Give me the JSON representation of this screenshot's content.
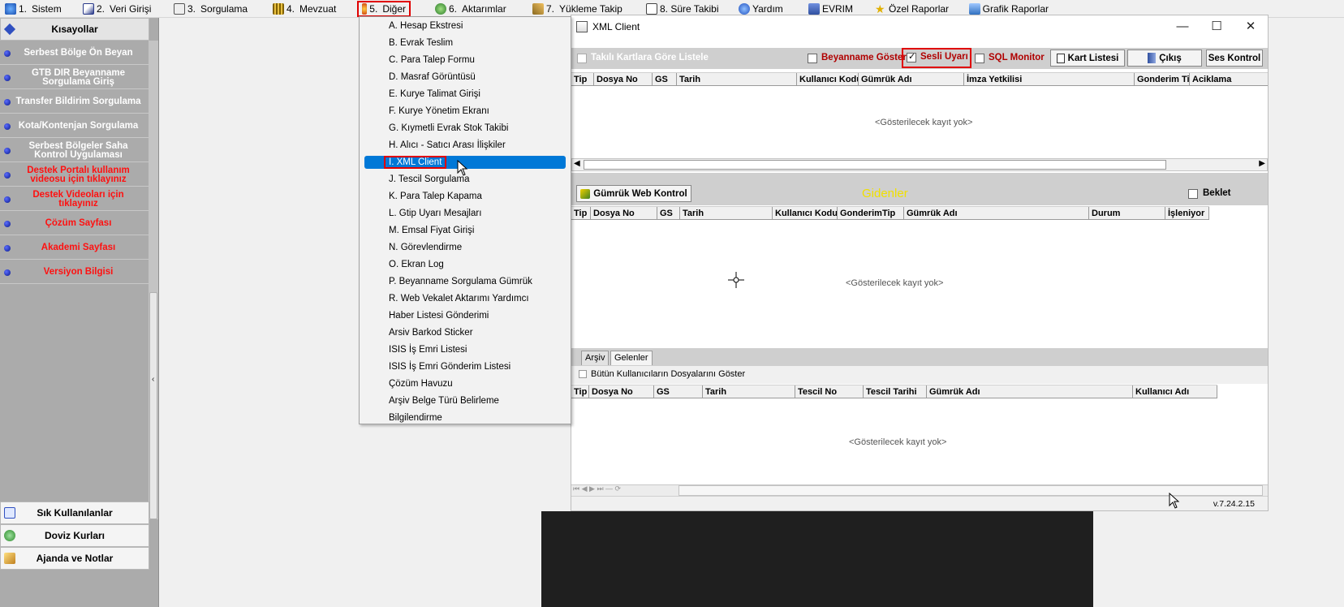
{
  "menubar": {
    "items": [
      {
        "key": "1.",
        "label": "Sistem",
        "icon": "system-icon",
        "color": "#1a4fb0"
      },
      {
        "key": "2.",
        "label": "Veri Girişi",
        "icon": "data-entry-icon",
        "color": "#2a3a8a"
      },
      {
        "key": "3.",
        "label": "Sorgulama",
        "icon": "query-icon",
        "color": "#555555"
      },
      {
        "key": "4.",
        "label": "Mevzuat",
        "icon": "legislation-icon",
        "color": "#806000"
      },
      {
        "key": "5.",
        "label": "Diğer",
        "icon": "other-icon",
        "color": "#d04010"
      },
      {
        "key": "6.",
        "label": "Aktarımlar",
        "icon": "transfer-icon",
        "color": "#2a7a2a"
      },
      {
        "key": "7.",
        "label": "Yükleme Takip",
        "icon": "upload-track-icon",
        "color": "#8a6a20"
      },
      {
        "key": "",
        "label": "8. Süre Takibi",
        "icon": "time-track-icon",
        "color": "#444444"
      },
      {
        "key": "",
        "label": "Yardım",
        "icon": "help-icon",
        "color": "#2050c0"
      },
      {
        "key": "",
        "label": "EVRIM",
        "icon": "evrim-icon",
        "color": "#3050a0"
      },
      {
        "key": "",
        "label": "Özel Raporlar",
        "icon": "star-icon",
        "color": "#e0b000"
      },
      {
        "key": "",
        "label": "Grafik Raporlar",
        "icon": "chart-icon",
        "color": "#3070c0"
      }
    ]
  },
  "sidebar": {
    "header": "Kısayollar",
    "items": [
      {
        "label": "Serbest Bölge Ön Beyan",
        "red": false
      },
      {
        "label": "GTB DIR Beyanname Sorgulama Giriş",
        "red": false
      },
      {
        "label": "Transfer Bildirim Sorgulama",
        "red": false
      },
      {
        "label": "Kota/Kontenjan Sorgulama",
        "red": false
      },
      {
        "label": "Serbest Bölgeler Saha Kontrol Uygulaması",
        "red": false
      },
      {
        "label": "Destek Portalı kullanım videosu için tıklayınız",
        "red": true
      },
      {
        "label": "Destek Videoları için tıklayınız",
        "red": true
      },
      {
        "label": "Çözüm Sayfası",
        "red": true
      },
      {
        "label": "Akademi Sayfası",
        "red": true
      },
      {
        "label": "Versiyon Bilgisi",
        "red": true
      }
    ],
    "bottom": [
      {
        "label": "Sık Kullanılanlar",
        "icon": "favorites-icon"
      },
      {
        "label": "Doviz Kurları",
        "icon": "currency-icon"
      },
      {
        "label": "Ajanda ve Notlar",
        "icon": "agenda-icon"
      }
    ]
  },
  "dropdown": {
    "items": [
      "A. Hesap Ekstresi",
      "B. Evrak Teslim",
      "C. Para Talep Formu",
      "D. Masraf Görüntüsü",
      "E. Kurye Talimat Girişi",
      "F. Kurye Yönetim Ekranı",
      "G. Kıymetli Evrak Stok Takibi",
      "H. Alıcı - Satıcı Arası İlişkiler",
      "I. XML Client",
      "J. Tescil Sorgulama",
      "K. Para Talep Kapama",
      "L. Gtip Uyarı Mesajları",
      "M. Emsal Fiyat Girişi",
      "N. Görevlendirme",
      "O. Ekran Log",
      "P. Beyanname Sorgulama Gümrük",
      "R. Web Vekalet Aktarımı Yardımcı",
      "Haber Listesi Gönderimi",
      "Arsiv Barkod Sticker",
      "ISIS İş Emri Listesi",
      "ISIS İş Emri Gönderim Listesi",
      "Çözüm Havuzu",
      "Arşiv Belge Türü Belirleme",
      "Bilgilendirme"
    ],
    "selected_index": 8
  },
  "xml_window": {
    "title": "XML Client",
    "toolbar": {
      "takili_label": "Takılı Kartlara Göre Listele",
      "beyanname_label": "Beyanname Göster",
      "sesli_label": "Sesli Uyarı",
      "sesli_checked": true,
      "sql_label": "SQL Monitor",
      "kart_listesi": "Kart Listesi",
      "cikis": "Çıkış",
      "ses_kontrol": "Ses Kontrol"
    },
    "grid1": {
      "columns": [
        "Tip",
        "Dosya No",
        "GS",
        "Tarih",
        "Kullanıcı Kodu",
        "Gümrük Adı",
        "İmza Yetkilisi",
        "Gonderim Tipi",
        "Aciklama"
      ],
      "empty_text": "<Gösterilecek kayıt yok>"
    },
    "gidenler": {
      "button": "Gümrük Web Kontrol",
      "title": "Gidenler",
      "beklet_label": "Beklet",
      "columns": [
        "Tip",
        "Dosya No",
        "GS",
        "Tarih",
        "Kullanıcı Kodu",
        "GonderimTip",
        "Gümrük Adı",
        "Durum",
        "İşleniyor"
      ],
      "empty_text": "<Gösterilecek kayıt yok>"
    },
    "tabs": [
      "Arşiv",
      "Gelenler"
    ],
    "active_tab": 1,
    "gelenler": {
      "show_all_label": "Bütün Kullanıcıların Dosyalarını Göster",
      "columns": [
        "Tip",
        "Dosya No",
        "GS",
        "Tarih",
        "Tescil No",
        "Tescil Tarihi",
        "Gümrük Adı",
        "Kullanıcı Adı"
      ],
      "empty_text": "<Gösterilecek kayıt yok>"
    },
    "version": "v.7.24.2.15"
  },
  "colors": {
    "accent_red": "#e00000",
    "selection_blue": "#0078d7",
    "gidenler_yellow": "#f0e000",
    "sidebar_bg": "#ababab"
  }
}
